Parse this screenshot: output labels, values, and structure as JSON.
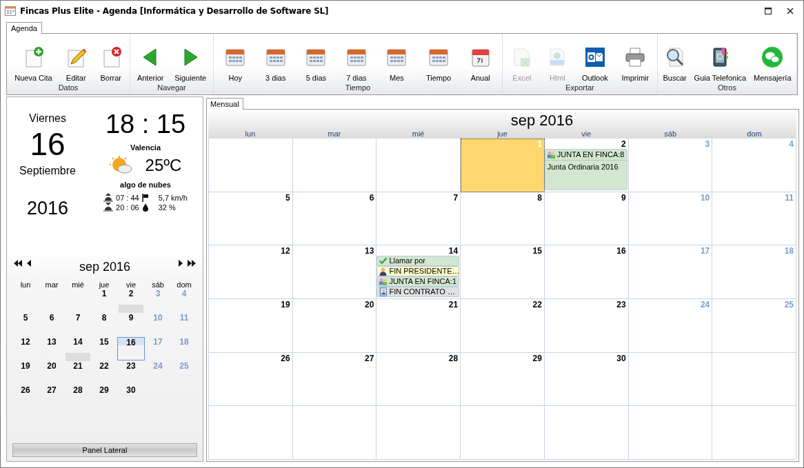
{
  "window": {
    "title": "Fincas Plus Elite - Agenda [Informática y Desarrollo de Software SL]"
  },
  "ribbon_tabs": [
    {
      "label": "Agenda",
      "selected": true
    }
  ],
  "ribbon_groups": [
    {
      "label": "Datos",
      "items": [
        {
          "label": "Nueva Cita",
          "kind": "doc-add",
          "disabled": false
        },
        {
          "label": "Editar",
          "kind": "doc-edit",
          "disabled": false
        },
        {
          "label": "Borrar",
          "kind": "doc-delete",
          "disabled": false
        }
      ]
    },
    {
      "label": "Navegar",
      "items": [
        {
          "label": "Anterior",
          "kind": "arrow-left",
          "disabled": false
        },
        {
          "label": "Siguiente",
          "kind": "arrow-right",
          "disabled": false
        }
      ]
    },
    {
      "label": "Tiempo",
      "items": [
        {
          "label": "Hoy",
          "kind": "calendar",
          "disabled": false
        },
        {
          "label": "3 dias",
          "kind": "calendar",
          "disabled": false
        },
        {
          "label": "5 dias",
          "kind": "calendar",
          "disabled": false
        },
        {
          "label": "7 dias",
          "kind": "calendar",
          "disabled": false
        },
        {
          "label": "Mes",
          "kind": "calendar",
          "disabled": false
        },
        {
          "label": "Tiempo",
          "kind": "calendar",
          "disabled": false
        },
        {
          "label": "Anual",
          "kind": "calendar-page",
          "disabled": false
        }
      ]
    },
    {
      "label": "Exportar",
      "items": [
        {
          "label": "Excel",
          "kind": "spreadsheet",
          "disabled": true
        },
        {
          "label": "Html",
          "kind": "html",
          "disabled": true
        },
        {
          "label": "Outlook",
          "kind": "mail-app",
          "disabled": false
        },
        {
          "label": "Imprimir",
          "kind": "printer",
          "disabled": false
        }
      ]
    },
    {
      "label": "Otros",
      "items": [
        {
          "label": "Buscar",
          "kind": "search",
          "disabled": false
        },
        {
          "label": "Guia Telefonica",
          "kind": "phonebook",
          "disabled": false
        },
        {
          "label": "Mensajería",
          "kind": "chat",
          "disabled": false
        }
      ]
    }
  ],
  "today": {
    "weekday": "Viernes",
    "day": "16",
    "month": "Septiembre",
    "year": "2016",
    "time": "18 : 15",
    "city": "Valencia",
    "temperature": "25ºC",
    "conditions": "algo de nubes",
    "sunrise": "07 : 44",
    "sunset": "20 : 06",
    "wind": "5,7 km/h",
    "humidity": "32 %"
  },
  "side_calendar": {
    "title": "sep 2016",
    "weekdays": [
      "lun",
      "mar",
      "mié",
      "jue",
      "vie",
      "sáb",
      "dom"
    ],
    "weeks": [
      {
        "days": [
          {
            "kind": "blank"
          },
          {
            "kind": "blank"
          },
          {
            "kind": "blank"
          },
          {
            "kind": "day",
            "day": "1",
            "weekend": false,
            "busy": false,
            "selected": false
          },
          {
            "kind": "day",
            "day": "2",
            "weekend": false,
            "busy": true,
            "selected": false
          },
          {
            "kind": "day",
            "day": "3",
            "weekend": true,
            "busy": false,
            "selected": false
          },
          {
            "kind": "day",
            "day": "4",
            "weekend": true,
            "busy": false,
            "selected": false
          }
        ]
      },
      {
        "days": [
          {
            "kind": "day",
            "day": "5",
            "weekend": false,
            "busy": false,
            "selected": false
          },
          {
            "kind": "day",
            "day": "6",
            "weekend": false,
            "busy": false,
            "selected": false
          },
          {
            "kind": "day",
            "day": "7",
            "weekend": false,
            "busy": false,
            "selected": false
          },
          {
            "kind": "day",
            "day": "8",
            "weekend": false,
            "busy": false,
            "selected": false
          },
          {
            "kind": "day",
            "day": "9",
            "weekend": false,
            "busy": false,
            "selected": false
          },
          {
            "kind": "day",
            "day": "10",
            "weekend": true,
            "busy": false,
            "selected": false
          },
          {
            "kind": "day",
            "day": "11",
            "weekend": true,
            "busy": false,
            "selected": false
          }
        ]
      },
      {
        "days": [
          {
            "kind": "day",
            "day": "12",
            "weekend": false,
            "busy": false,
            "selected": false
          },
          {
            "kind": "day",
            "day": "13",
            "weekend": false,
            "busy": false,
            "selected": false
          },
          {
            "kind": "day",
            "day": "14",
            "weekend": false,
            "busy": true,
            "selected": false
          },
          {
            "kind": "day",
            "day": "15",
            "weekend": false,
            "busy": false,
            "selected": false
          },
          {
            "kind": "day",
            "day": "16",
            "weekend": false,
            "busy": false,
            "selected": true
          },
          {
            "kind": "day",
            "day": "17",
            "weekend": true,
            "busy": false,
            "selected": false
          },
          {
            "kind": "day",
            "day": "18",
            "weekend": true,
            "busy": false,
            "selected": false
          }
        ]
      },
      {
        "days": [
          {
            "kind": "day",
            "day": "19",
            "weekend": false,
            "busy": false,
            "selected": false
          },
          {
            "kind": "day",
            "day": "20",
            "weekend": false,
            "busy": false,
            "selected": false
          },
          {
            "kind": "day",
            "day": "21",
            "weekend": false,
            "busy": false,
            "selected": false
          },
          {
            "kind": "day",
            "day": "22",
            "weekend": false,
            "busy": false,
            "selected": false
          },
          {
            "kind": "day",
            "day": "23",
            "weekend": false,
            "busy": false,
            "selected": false
          },
          {
            "kind": "day",
            "day": "24",
            "weekend": true,
            "busy": false,
            "selected": false
          },
          {
            "kind": "day",
            "day": "25",
            "weekend": true,
            "busy": false,
            "selected": false
          }
        ]
      },
      {
        "days": [
          {
            "kind": "day",
            "day": "26",
            "weekend": false,
            "busy": false,
            "selected": false
          },
          {
            "kind": "day",
            "day": "27",
            "weekend": false,
            "busy": false,
            "selected": false
          },
          {
            "kind": "day",
            "day": "28",
            "weekend": false,
            "busy": false,
            "selected": false
          },
          {
            "kind": "day",
            "day": "29",
            "weekend": false,
            "busy": false,
            "selected": false
          },
          {
            "kind": "day",
            "day": "30",
            "weekend": false,
            "busy": false,
            "selected": false
          },
          {
            "kind": "blank"
          },
          {
            "kind": "blank"
          }
        ]
      }
    ],
    "panel_button": "Panel Lateral"
  },
  "view_tabs": [
    {
      "label": "Mensual",
      "selected": true
    }
  ],
  "month_view": {
    "title": "sep 2016",
    "weekdays": [
      "lun",
      "mar",
      "mié",
      "jue",
      "vie",
      "sáb",
      "dom"
    ],
    "weeks": [
      {
        "days": [
          {
            "kind": "blank"
          },
          {
            "kind": "blank"
          },
          {
            "kind": "blank"
          },
          {
            "kind": "day",
            "day": "1",
            "weekend": false,
            "selected": true
          },
          {
            "kind": "day",
            "day": "2",
            "weekend": false,
            "selected": false,
            "events": [
              {
                "kind": "meeting",
                "title": "JUNTA EN FINCA:8",
                "description": "Junta Ordinaria 2016",
                "color": "#d3e6cf"
              }
            ]
          },
          {
            "kind": "day",
            "day": "3",
            "weekend": true,
            "selected": false
          },
          {
            "kind": "day",
            "day": "4",
            "weekend": true,
            "selected": false
          }
        ]
      },
      {
        "days": [
          {
            "kind": "day",
            "day": "5",
            "weekend": false,
            "selected": false
          },
          {
            "kind": "day",
            "day": "6",
            "weekend": false,
            "selected": false
          },
          {
            "kind": "day",
            "day": "7",
            "weekend": false,
            "selected": false
          },
          {
            "kind": "day",
            "day": "8",
            "weekend": false,
            "selected": false
          },
          {
            "kind": "day",
            "day": "9",
            "weekend": false,
            "selected": false
          },
          {
            "kind": "day",
            "day": "10",
            "weekend": true,
            "selected": false
          },
          {
            "kind": "day",
            "day": "11",
            "weekend": true,
            "selected": false
          }
        ]
      },
      {
        "days": [
          {
            "kind": "day",
            "day": "12",
            "weekend": false,
            "selected": false
          },
          {
            "kind": "day",
            "day": "13",
            "weekend": false,
            "selected": false
          },
          {
            "kind": "day",
            "day": "14",
            "weekend": false,
            "selected": false,
            "events": [
              {
                "kind": "task",
                "title": "Llamar por",
                "color": "#d3e6cf"
              },
              {
                "kind": "person",
                "title": "FIN PRESIDENTE…",
                "color": "#fdfbc8"
              },
              {
                "kind": "meeting",
                "title": "JUNTA EN FINCA:1",
                "color": "#d3e6cf"
              },
              {
                "kind": "contract",
                "title": "FIN CONTRATO …",
                "color": "#e0e0e0"
              }
            ]
          },
          {
            "kind": "day",
            "day": "15",
            "weekend": false,
            "selected": false
          },
          {
            "kind": "day",
            "day": "16",
            "weekend": false,
            "selected": false
          },
          {
            "kind": "day",
            "day": "17",
            "weekend": true,
            "selected": false
          },
          {
            "kind": "day",
            "day": "18",
            "weekend": true,
            "selected": false
          }
        ]
      },
      {
        "days": [
          {
            "kind": "day",
            "day": "19",
            "weekend": false,
            "selected": false
          },
          {
            "kind": "day",
            "day": "20",
            "weekend": false,
            "selected": false
          },
          {
            "kind": "day",
            "day": "21",
            "weekend": false,
            "selected": false
          },
          {
            "kind": "day",
            "day": "22",
            "weekend": false,
            "selected": false
          },
          {
            "kind": "day",
            "day": "23",
            "weekend": false,
            "selected": false
          },
          {
            "kind": "day",
            "day": "24",
            "weekend": true,
            "selected": false
          },
          {
            "kind": "day",
            "day": "25",
            "weekend": true,
            "selected": false
          }
        ]
      },
      {
        "days": [
          {
            "kind": "day",
            "day": "26",
            "weekend": false,
            "selected": false
          },
          {
            "kind": "day",
            "day": "27",
            "weekend": false,
            "selected": false
          },
          {
            "kind": "day",
            "day": "28",
            "weekend": false,
            "selected": false
          },
          {
            "kind": "day",
            "day": "29",
            "weekend": false,
            "selected": false
          },
          {
            "kind": "day",
            "day": "30",
            "weekend": false,
            "selected": false
          },
          {
            "kind": "blank"
          },
          {
            "kind": "blank"
          }
        ]
      },
      {
        "days": [
          {
            "kind": "blank"
          },
          {
            "kind": "blank"
          },
          {
            "kind": "blank"
          },
          {
            "kind": "blank"
          },
          {
            "kind": "blank"
          },
          {
            "kind": "blank"
          },
          {
            "kind": "blank"
          }
        ]
      }
    ]
  }
}
